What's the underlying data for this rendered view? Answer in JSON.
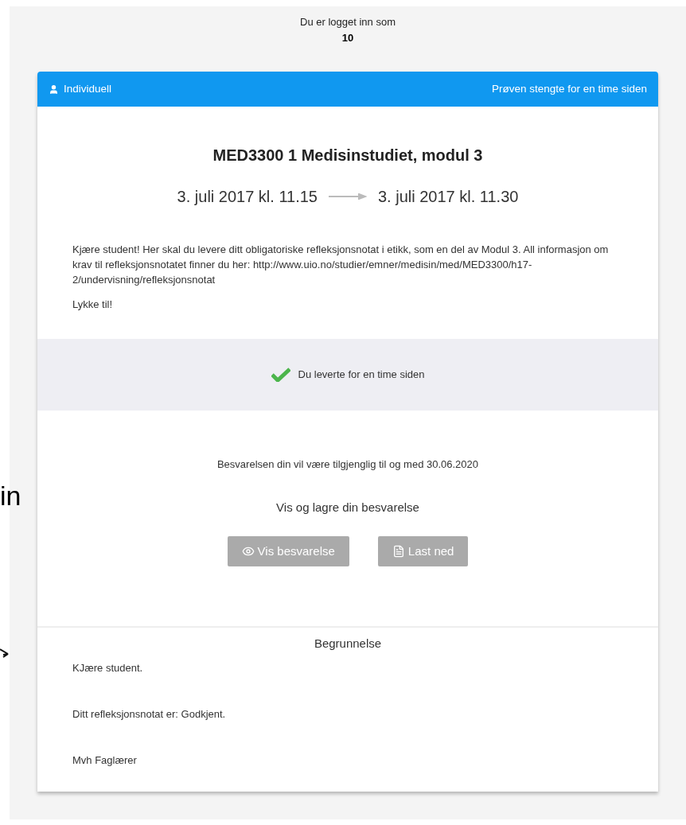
{
  "login": {
    "label": "Du er logget inn som",
    "user": "10"
  },
  "header": {
    "type": "Individuell",
    "status": "Prøven stengte for en time siden"
  },
  "exam": {
    "title": "MED3300 1 Medisinstudiet, modul 3",
    "start": "3. juli 2017 kl. 11.15",
    "end": "3. juli 2017 kl. 11.30"
  },
  "description": [
    "Kjære student! Her skal du levere ditt obligatoriske refleksjonsnotat i etikk, som en del av Modul 3. All informasjon om krav til refleksjonsnotatet finner du her: http://www.uio.no/studier/emner/medisin/med/MED3300/h17-2/undervisning/refleksjonsnotat",
    "Lykke til!"
  ],
  "delivery": {
    "status": "Du leverte for en time siden"
  },
  "availability": "Besvarelsen din vil være tilgjenglig til og med 30.06.2020",
  "view_heading": "Vis og lagre din besvarelse",
  "buttons": [
    {
      "kind": "view",
      "label": "Vis besvarelse"
    },
    {
      "kind": "download",
      "label": "Last ned"
    }
  ],
  "justification": {
    "title": "Begrunnelse",
    "lines": [
      "KJære student.",
      "Ditt refleksjonsnotat er: Godkjent.",
      "Mvh Faglærer"
    ]
  },
  "annotation": {
    "text": "in"
  }
}
